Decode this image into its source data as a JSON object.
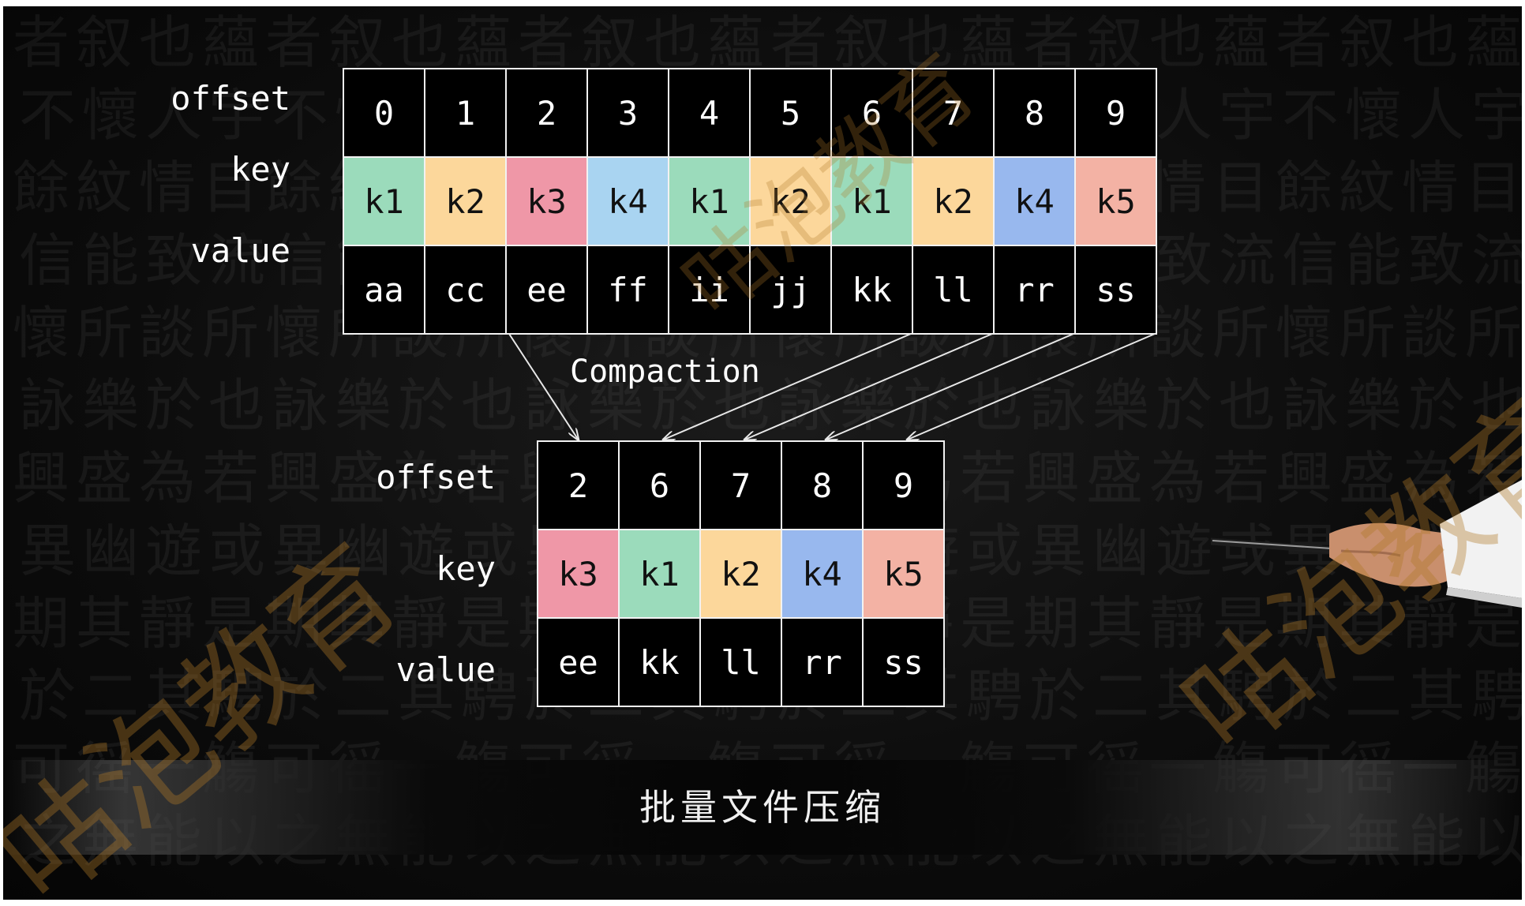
{
  "diagram": {
    "top_table": {
      "row_labels": {
        "offset": "offset",
        "key": "key",
        "value": "value"
      },
      "offsets": [
        "0",
        "1",
        "2",
        "3",
        "4",
        "5",
        "6",
        "7",
        "8",
        "9"
      ],
      "keys": [
        "k1",
        "k2",
        "k3",
        "k4",
        "k1",
        "k2",
        "k1",
        "k2",
        "k4",
        "k5"
      ],
      "values": [
        "aa",
        "cc",
        "ee",
        "ff",
        "ii",
        "jj",
        "kk",
        "ll",
        "rr",
        "ss"
      ]
    },
    "arrow_label": "Compaction",
    "bottom_table": {
      "row_labels": {
        "offset": "offset",
        "key": "key",
        "value": "value"
      },
      "offsets": [
        "2",
        "6",
        "7",
        "8",
        "9"
      ],
      "keys": [
        "k3",
        "k1",
        "k2",
        "k4",
        "k5"
      ],
      "values": [
        "ee",
        "kk",
        "ll",
        "rr",
        "ss"
      ]
    },
    "arrow_links": [
      {
        "from_offset": "2",
        "to_offset": "2"
      },
      {
        "from_offset": "6",
        "to_offset": "6"
      },
      {
        "from_offset": "7",
        "to_offset": "7"
      },
      {
        "from_offset": "8",
        "to_offset": "8"
      },
      {
        "from_offset": "9",
        "to_offset": "9"
      }
    ],
    "key_colors": {
      "k1": "#9bdbbb",
      "k2": "#fcd79b",
      "k3": "#ef97a7",
      "k4": "#a9d4f1",
      "k5": "#f3b2a4"
    },
    "key_colors_bottom": {
      "k4": "#98b8ee"
    },
    "key_colors_top_index8": "#98b8ee"
  },
  "caption": "批量文件压缩",
  "watermark": "咕泡教育",
  "colors": {
    "background": "#0c0c0c",
    "grid_line": "#f2f2f2",
    "text": "#ffffff",
    "watermark": "#b07828"
  }
}
